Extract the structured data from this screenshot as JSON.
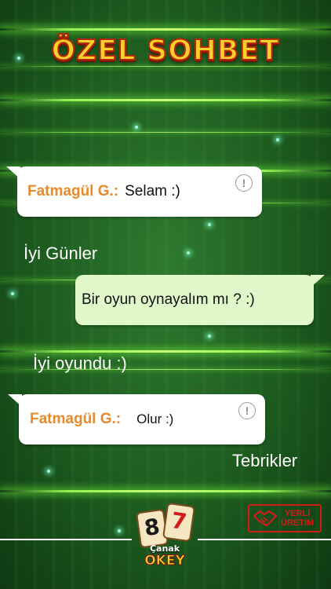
{
  "header": {
    "title": "ÖZEL SOHBET"
  },
  "chat": {
    "messages": [
      {
        "sender": "Fatmagül G.:",
        "text": "Selam :)"
      },
      {
        "text": "İyi Günler"
      },
      {
        "text": "Bir oyun oynayalım mı ? :)"
      },
      {
        "text": "İyi oyundu :)"
      },
      {
        "sender": "Fatmagül G.:",
        "text": "Olur :)"
      },
      {
        "text": "Tebrikler"
      }
    ],
    "info_icon_glyph": "!"
  },
  "footer": {
    "logo": {
      "tile_left": "8",
      "tile_right": "7",
      "line1": "Çanak",
      "line2": "OKEY"
    },
    "badge": {
      "line1": "YERLİ",
      "line2": "ÜRETİM",
      "icon": "handshake-icon"
    }
  },
  "colors": {
    "background": "#1d5a1f",
    "sender": "#e8892a",
    "accent_glow": "#c8ff7a",
    "badge": "#d21b1b"
  }
}
